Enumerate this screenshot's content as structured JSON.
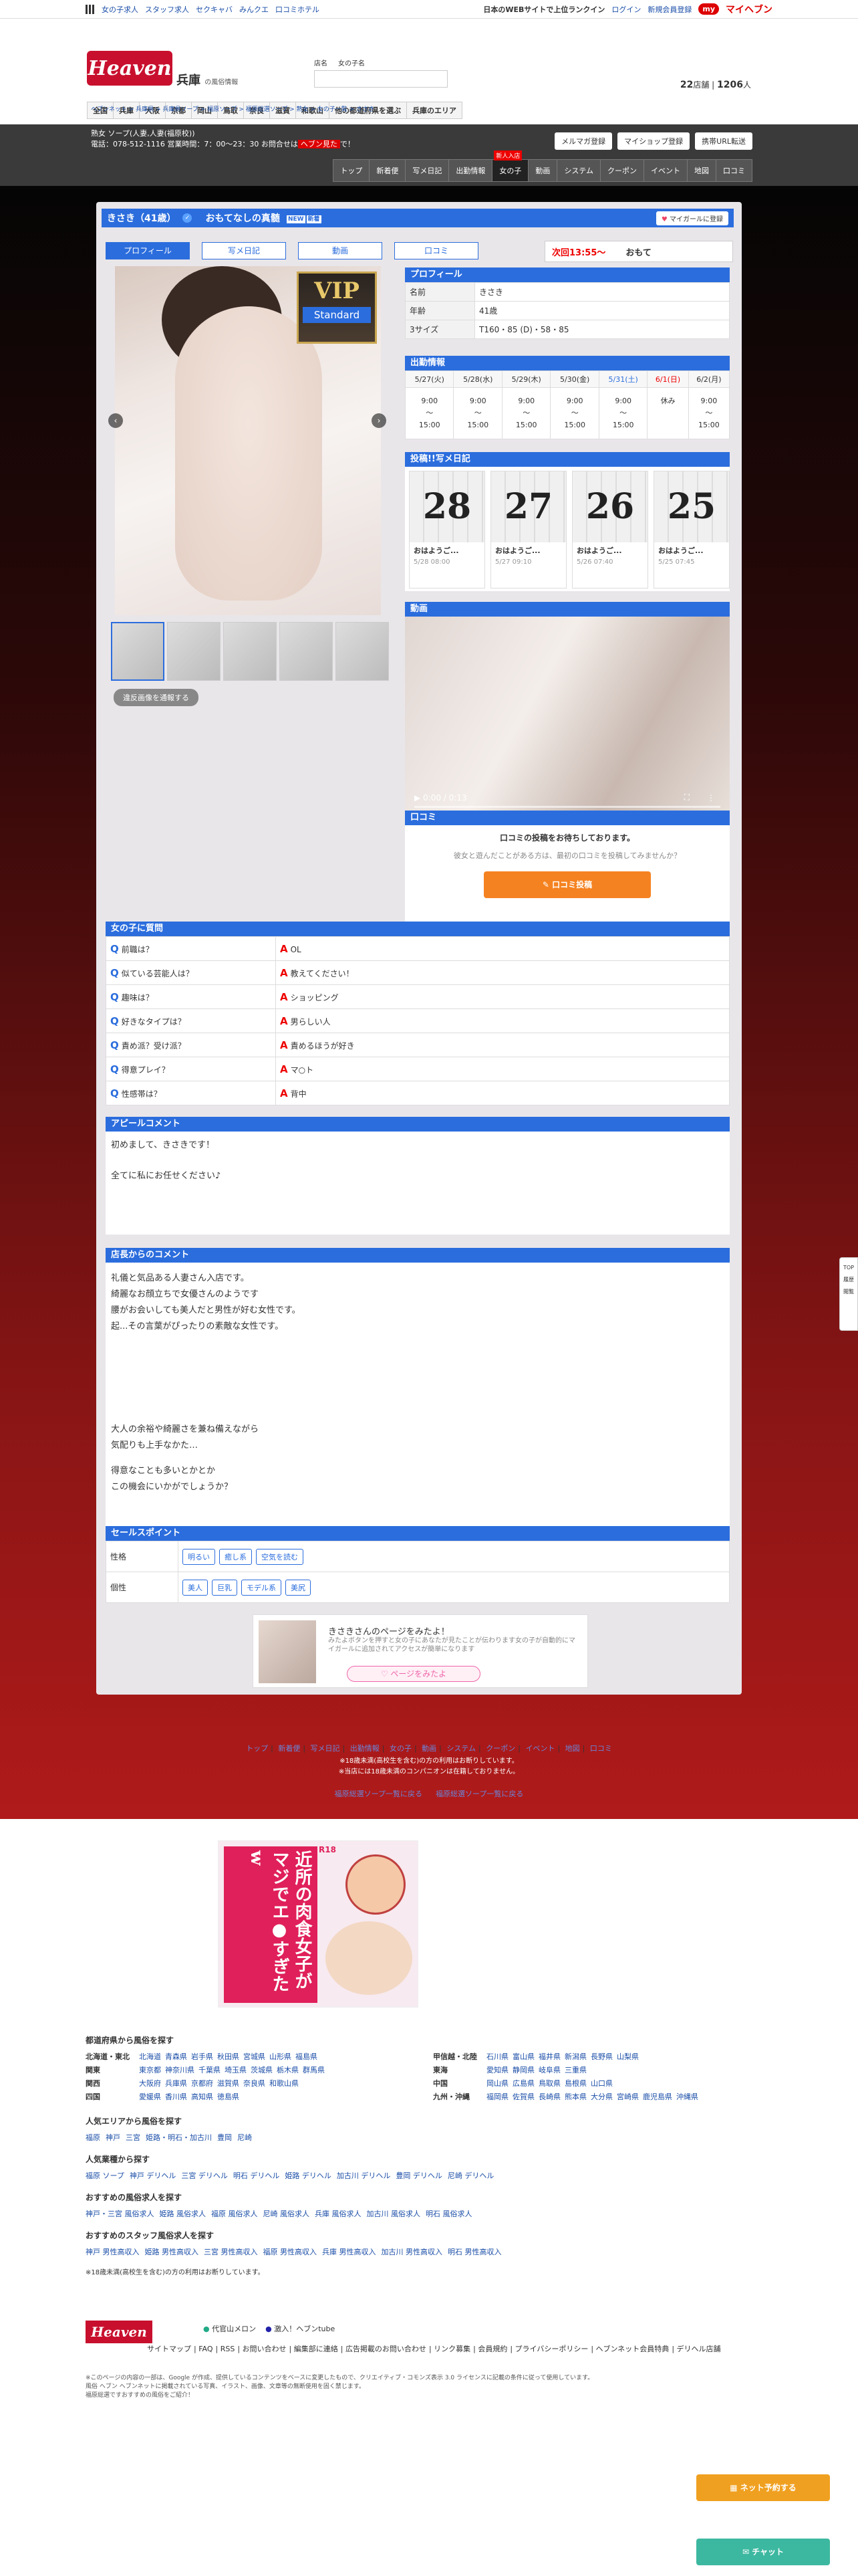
{
  "topbar": {
    "links": [
      "女の子求人",
      "スタッフ求人",
      "セクキャバ",
      "みんクエ",
      "口コミホテル"
    ],
    "right_text": "日本のWEBサイトで上位ランクイン",
    "login": "ログイン",
    "register": "新規会員登録",
    "my_heaven": "マイヘブン",
    "my_badge": "my"
  },
  "header": {
    "logo": "Heaven",
    "region": "兵庫",
    "region_sub": "の風俗情報",
    "search_label_1": "店名",
    "search_label_2": "女の子名",
    "search_placeholder": "",
    "count_shops": "22",
    "count_shops_unit": "店舗",
    "count_girls": "1206",
    "count_girls_unit": "人"
  },
  "areanav": [
    "全国",
    "兵庫",
    "大阪",
    "京都",
    "岡山",
    "鳥取",
    "奈良",
    "滋賀",
    "和歌山",
    "他の都道府県を選ぶ",
    "兵庫のエリア"
  ],
  "shop": {
    "line1": "熟女 ソープ(人妻,人妻(福原校))",
    "line2": "電話：078-512-1116 営業時間：7：00〜23：30 お問合せは",
    "line2_red": "ヘブン見た",
    "line2_end": "で！",
    "btn_mail": "メルマガ登録",
    "btn_myshop": "マイショップ登録",
    "btn_url": "携帯URL転送",
    "nav": [
      "トップ",
      "新着便",
      "写メ日記",
      "出勤情報",
      "女の子",
      "動画",
      "システム",
      "クーポン",
      "イベント",
      "地図",
      "口コミ"
    ],
    "nav_new": "新人入店"
  },
  "breadcrumb": "ヘブンネット > 兵庫県 > 兵庫県ソープ > 福原ソープ > 福原総選ソープ > 熟女 > 女の子一覧 > きさき",
  "girl": {
    "name": "きさき（41歳）",
    "check": "✓",
    "catch": "おもてなしの真髄",
    "badges": [
      "NEW",
      "新着"
    ],
    "mygirl": "マイガールに登録"
  },
  "tabs": [
    "プロフィール",
    "写メ日記",
    "動画",
    "口コミ"
  ],
  "next": {
    "label": "次回13:55〜",
    "text": "おもて"
  },
  "vip": {
    "v": "VIP",
    "s": "Standard"
  },
  "violation": "違反画像を通報する",
  "profile": {
    "head": "プロフィール",
    "rows": [
      {
        "k": "名前",
        "v": "きさき"
      },
      {
        "k": "年齢",
        "v": "41歳"
      },
      {
        "k": "3サイズ",
        "v": "T160・85 (D)・58・85"
      }
    ]
  },
  "schedule": {
    "head": "出勤情報",
    "days": [
      "5/27(火)",
      "5/28(水)",
      "5/29(木)",
      "5/30(金)",
      "5/31(土)",
      "6/1(日)",
      "6/2(月)"
    ],
    "start": [
      "9:00",
      "9:00",
      "9:00",
      "9:00",
      "9:00",
      "休み",
      "9:00"
    ],
    "sep": [
      "〜",
      "〜",
      "〜",
      "〜",
      "〜",
      "",
      "〜"
    ],
    "end": [
      "15:00",
      "15:00",
      "15:00",
      "15:00",
      "15:00",
      "",
      "15:00"
    ]
  },
  "diary": {
    "head": "投稿!!写メ日記",
    "cards": [
      {
        "day": "28",
        "title": "おはようご...",
        "date": "5/28 08:00"
      },
      {
        "day": "27",
        "title": "おはようご...",
        "date": "5/27 09:10"
      },
      {
        "day": "26",
        "title": "おはようご...",
        "date": "5/26 07:40"
      },
      {
        "day": "25",
        "title": "おはようご...",
        "date": "5/25 07:45"
      }
    ]
  },
  "video": {
    "head": "動画",
    "time": "▶  0:00 / 0:13"
  },
  "kuchikomi": {
    "head": "口コミ",
    "b1": "口コミの投稿をお待ちしております。",
    "b2": "彼女と遊んだことがある方は、最初の口コミを投稿してみませんか？",
    "btn": "✎ 口コミ投稿"
  },
  "qa": {
    "head": "女の子に質問",
    "q": "Q",
    "a": "A",
    "rows": [
      {
        "q": "前職は？",
        "a": "OL"
      },
      {
        "q": "似ている芸能人は？",
        "a": "教えてください！"
      },
      {
        "q": "趣味は？",
        "a": "ショッピング"
      },
      {
        "q": "好きなタイプは？",
        "a": "男らしい人"
      },
      {
        "q": "責め派？受け派？",
        "a": "責めるほうが好き"
      },
      {
        "q": "得意プレイ？",
        "a": "マ○ト"
      },
      {
        "q": "性感帯は？",
        "a": "背中"
      }
    ]
  },
  "appeal": {
    "head": "アピールコメント",
    "lines": [
      "初めまして、きさきです！",
      "全てに私にお任せください♪"
    ]
  },
  "comment": {
    "head": "店長からのコメント",
    "lines1": [
      "礼儀と気品ある人妻さん入店です。",
      "綺麗なお顔立ちで女優さんのようです",
      "腰がお会いしても美人だと男性が好む女性です。",
      "起...その言葉がぴったりの素敵な女性です。"
    ],
    "lines2": [
      "大人の余裕や綺麗さを兼ね備えながら",
      "気配りも上手なかた…",
      "得意なことも多いとかとか",
      "この機会にいかがでしょうか？"
    ]
  },
  "sales": {
    "head": "セールスポイント",
    "rows": [
      {
        "k": "性格",
        "v": [
          "明るい",
          "癒し系",
          "空気を読む"
        ]
      },
      {
        "k": "個性",
        "v": [
          "美人",
          "巨乳",
          "モデル系",
          "美尻"
        ]
      }
    ]
  },
  "banner": {
    "t1": "きさきさんのページをみたよ！",
    "t2": "みたよボタンを押すと女の子にあなたが見たことが伝わります女の子が自動的にマイガールに追加されてアクセスが簡単になります",
    "btn": "♡ ページをみたよ"
  },
  "fnav": {
    "links": [
      "トップ",
      "新着便",
      "写メ日記",
      "出勤情報",
      "女の子",
      "動画",
      "システム",
      "クーポン",
      "イベント",
      "地図",
      "口コミ"
    ],
    "note1": "※18歳未満(高校生を含む)の方の利用はお断りしています。",
    "note2": "※当店には18歳未満のコンパニオンは在籍しておりません。",
    "links2": [
      "福原総選ソープ一覧に戻る",
      "福原総選ソープ一覧に戻る"
    ]
  },
  "ad": {
    "text": "近所の肉食女子がマジでエ●すぎたw",
    "r18": "R18"
  },
  "pref": {
    "head": "都道府県から風俗を探す",
    "left": [
      {
        "k": "北海道・東北",
        "v": [
          "北海道",
          "青森県",
          "岩手県",
          "秋田県",
          "宮城県",
          "山形県",
          "福島県"
        ]
      },
      {
        "k": "関東",
        "v": [
          "東京都",
          "神奈川県",
          "千葉県",
          "埼玉県",
          "茨城県",
          "栃木県",
          "群馬県"
        ]
      },
      {
        "k": "関西",
        "v": [
          "大阪府",
          "兵庫県",
          "京都府",
          "滋賀県",
          "奈良県",
          "和歌山県"
        ]
      },
      {
        "k": "四国",
        "v": [
          "愛媛県",
          "香川県",
          "高知県",
          "徳島県"
        ]
      }
    ],
    "right": [
      {
        "k": "甲信越・北陸",
        "v": [
          "石川県",
          "富山県",
          "福井県",
          "新潟県",
          "長野県",
          "山梨県"
        ]
      },
      {
        "k": "東海",
        "v": [
          "愛知県",
          "静岡県",
          "岐阜県",
          "三重県"
        ]
      },
      {
        "k": "中国",
        "v": [
          "岡山県",
          "広島県",
          "鳥取県",
          "島根県",
          "山口県"
        ]
      },
      {
        "k": "九州・沖縄",
        "v": [
          "福岡県",
          "佐賀県",
          "長崎県",
          "熊本県",
          "大分県",
          "宮崎県",
          "鹿児島県",
          "沖縄県"
        ]
      }
    ]
  },
  "popular_area": {
    "head": "人気エリアから風俗を探す",
    "items": [
      "福原",
      "神戸",
      "三宮",
      "姫路・明石・加古川",
      "豊岡",
      "尼崎"
    ]
  },
  "popular_kind": {
    "head": "人気業種から探す",
    "items": [
      "福原 ソープ",
      "神戸 デリヘル",
      "三宮 デリヘル",
      "明石 デリヘル",
      "姫路 デリヘル",
      "加古川 デリヘル",
      "豊岡 デリヘル",
      "尼崎 デリヘル"
    ]
  },
  "rec_job": {
    "head": "おすすめの風俗求人を探す",
    "items": [
      "神戸・三宮 風俗求人",
      "姫路 風俗求人",
      "福原 風俗求人",
      "尼崎 風俗求人",
      "兵庫 風俗求人",
      "加古川 風俗求人",
      "明石 風俗求人"
    ]
  },
  "rec_staff": {
    "head": "おすすめのスタッフ風俗求人を探す",
    "items": [
      "神戸 男性高収入",
      "姫路 男性高収入",
      "三宮 男性高収入",
      "福原 男性高収入",
      "兵庫 男性高収入",
      "加古川 男性高収入",
      "明石 男性高収入"
    ]
  },
  "age_note": "※18歳未満(高校生を含む)の方の利用はお断りしています。",
  "footer": {
    "logo": "Heaven",
    "sns1": "代官山メロン",
    "sns2": "激入！ヘブンtube",
    "links": [
      "サイトマップ",
      "FAQ",
      "RSS",
      "お問い合わせ",
      "編集部に連絡",
      "広告掲載のお問い合わせ",
      "リンク募集",
      "会員規約",
      "プライバシーポリシー",
      "ヘブンネット会員特典",
      "デリヘル店舗"
    ],
    "small1": "※このページの内容の一部は、Google が作成、提供しているコンテンツをベースに変更したもので、クリエイティブ・コモンズ表示 3.0 ライセンスに記載の条件に従って使用しています。",
    "small2": "風俗 ヘブン ヘブンネットに掲載されている写真、イラスト、画像、文章等の無断使用を固く禁じます。",
    "small3": "福原総選ですおすすめの風俗をご紹介！"
  },
  "fab": {
    "net": "ネット予約する",
    "chat": "チャット"
  },
  "float": {
    "a": "TOP",
    "b": "履歴",
    "c": "閲覧"
  }
}
